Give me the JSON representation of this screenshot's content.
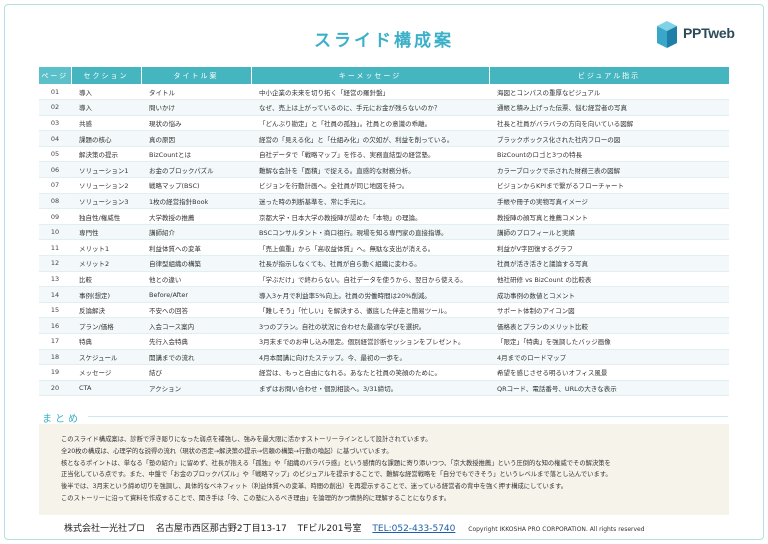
{
  "page": {
    "title": "スライド構成案"
  },
  "logo": {
    "text": "PPTweb"
  },
  "table": {
    "headers": [
      "ページ",
      "セクション",
      "タイトル案",
      "キーメッセージ",
      "ビジュアル指示"
    ],
    "rows": [
      [
        "01",
        "導入",
        "タイトル",
        "中小企業の未来を切り拓く「経営の羅針盤」",
        "海図とコンパスの重厚なビジュアル"
      ],
      [
        "02",
        "導入",
        "問いかけ",
        "なぜ、売上は上がっているのに、手元にお金が残らないのか？",
        "通帳と積み上げった伝票、悩む経営者の写真"
      ],
      [
        "03",
        "共感",
        "現状の悩み",
        "「どんぶり勘定」と「社員の孤独」。社員との意識の乖離。",
        "社長と社員がバラバラの方向を向いている図解"
      ],
      [
        "04",
        "課題の核心",
        "真の原因",
        "経営の「見える化」と「仕組み化」の欠如が、利益を削っている。",
        "ブラックボックス化された社内フローの図"
      ],
      [
        "05",
        "解決策の提示",
        "BizCountとは",
        "自社データで「戦略マップ」を作る、実務直結型の経営塾。",
        "BizCountのロゴと3つの特長"
      ],
      [
        "06",
        "ソリューション1",
        "お金のブロックパズル",
        "難解な会計を「面積」で捉える。直感的な財務分析。",
        "カラーブロックで示された財務三表の図解"
      ],
      [
        "07",
        "ソリューション2",
        "戦略マップ(BSC)",
        "ビジョンを行動計画へ。全社員が同じ地図を持つ。",
        "ビジョンからKPIまで繋がるフローチャート"
      ],
      [
        "08",
        "ソリューション3",
        "1枚の経営指針Book",
        "迷った時の判断基準を、常に手元に。",
        "手帳や冊子の実物写真イメージ"
      ],
      [
        "09",
        "独自性/権威性",
        "大学教授の推薦",
        "京都大学・日本大学の教授陣が認めた「本物」の理論。",
        "教授陣の顔写真と推薦コメント"
      ],
      [
        "10",
        "専門性",
        "講師紹介",
        "BSCコンサルタント・商口祖行。現場を知る専門家の直接指導。",
        "講師のプロフィールと実績"
      ],
      [
        "11",
        "メリット1",
        "利益体質への変革",
        "「売上偏重」から「高収益体質」へ。無駄な支出が消える。",
        "利益がV字回復するグラフ"
      ],
      [
        "12",
        "メリット2",
        "自律型組織の構築",
        "社長が指示しなくても、社員が自ら動く組織に変わる。",
        "社員が活き活きと議論する写真"
      ],
      [
        "13",
        "比較",
        "他との違い",
        "「学ぶだけ」で終わらない。自社データを使うから、翌日から使える。",
        "他社研修 vs BizCount の比較表"
      ],
      [
        "14",
        "事例(想定)",
        "Before/After",
        "導入3ヶ月で利益率5%向上。社員の労働時間は20%削減。",
        "成功事例の数値とコメント"
      ],
      [
        "15",
        "反論解決",
        "不安への回答",
        "「難しそう」「忙しい」を解決する、徹底した伴走と簡易ツール。",
        "サポート体制のアイコン図"
      ],
      [
        "16",
        "プラン/価格",
        "入会コース案内",
        "3つのプラン。自社の状況に合わせた最適な学びを選択。",
        "価格表とプランのメリット比較"
      ],
      [
        "17",
        "特典",
        "先行入会特典",
        "3月末までのお申し込み限定。個別経営診断セッションをプレゼント。",
        "「限定」「特典」を強調したバッジ画像"
      ],
      [
        "18",
        "スケジュール",
        "開講までの流れ",
        "4月本開講に向けたステップ。今、最初の一歩を。",
        "4月までのロードマップ"
      ],
      [
        "19",
        "メッセージ",
        "結び",
        "経営は、もっと自由になれる。あなたと社員の笑顔のために。",
        "希望を感じさせる明るいオフィス風景"
      ],
      [
        "20",
        "CTA",
        "アクション",
        "まずはお問い合わせ・個別相談へ。3/31締切。",
        "QRコード、電話番号、URLの大きな表示"
      ]
    ]
  },
  "summary": {
    "heading": "まとめ",
    "lines": [
      "このスライド構成案は、診断で浮き彫りになった弱点を補強し、強みを最大限に活かすストーリーラインとして設計されています。",
      "全20枚の構成は、心理学的な説得の流れ（現状の否定→解決策の提示→信頼の構築→行動の喚起）に基づいています。",
      "核となるポイントは、単なる「塾の紹介」に留めず、社長が抱える「孤独」や「組織のバラバラ感」という感情的な課題に寄り添いつつ、「京大教授推薦」という圧倒的な知の権威でその解決策を",
      "正当化している点です。また、中盤で「お金のブロックパズル」や「戦略マップ」のビジュアルを提示することで、難解な経営戦略を「自分でもできそう」というレベルまで落とし込んでいます。",
      "後半では、3月末という締め切りを強調し、具体的なベネフィット（利益体質への変革、時間の創出）を再提示することで、迷っている経営者の背中を強く押す構成にしています。",
      "このストーリーに沿って資料を作成することで、聞き手は「今、この塾に入るべき理由」を論理的かつ情熱的に理解することになります。"
    ]
  },
  "footer": {
    "company": "株式会社一光社プロ",
    "address": "名古屋市西区那古野2丁目13-17",
    "building": "TFビル201号室",
    "tel": "TEL:052-433-5740",
    "copyright": "Copyright IKKOSHA PRO CORPORATION. All rights reserved"
  },
  "colors": {
    "accent": "#3bb0c9",
    "header_bg": "#45b5bf",
    "summary_bg": "#f6f3eb",
    "link": "#1b5fa8"
  }
}
